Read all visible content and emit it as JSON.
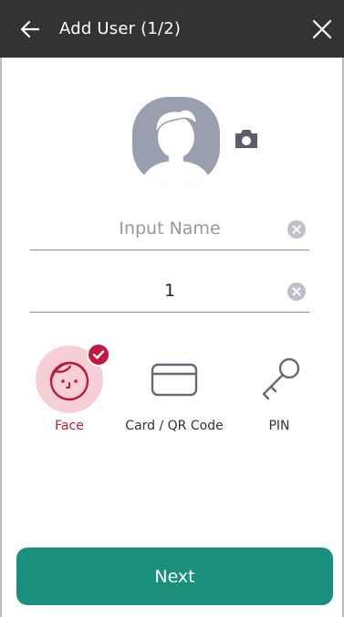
{
  "header": {
    "title": "Add User (1/2)"
  },
  "form": {
    "name_placeholder": "Input Name",
    "name_value": "",
    "id_value": "1"
  },
  "auth_methods": [
    {
      "label": "Face",
      "selected": true
    },
    {
      "label": "Card / QR Code",
      "selected": false
    },
    {
      "label": "PIN",
      "selected": false
    }
  ],
  "actions": {
    "next_label": "Next"
  },
  "colors": {
    "header_bg": "#333333",
    "accent": "#c2183f",
    "primary_button": "#1a8f7c",
    "face_highlight": "#f7cfd6"
  },
  "icons": {
    "back": "arrow-left-icon",
    "close": "close-icon",
    "avatar": "user-avatar-icon",
    "camera": "camera-icon",
    "clear": "clear-circle-icon",
    "face": "face-icon",
    "card": "card-icon",
    "pin": "key-icon",
    "selected": "check-badge-icon"
  }
}
